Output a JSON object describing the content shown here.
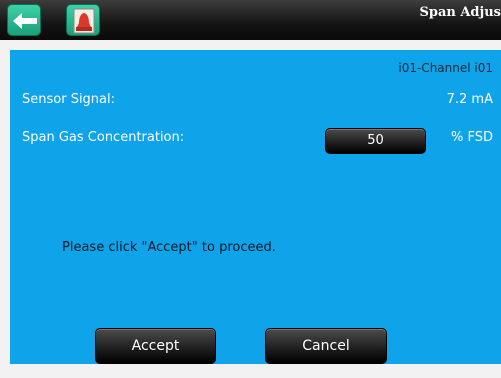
{
  "header": {
    "title": "Span Adjus",
    "back_icon": "back-arrow-icon",
    "alarm_icon": "alarm-bell-icon",
    "accent_color": "#1aa07a"
  },
  "panel": {
    "background_color": "#0fa3ea",
    "channel": "i01-Channel i01",
    "sensor_signal_label": "Sensor Signal:",
    "sensor_signal_value": "7.2 mA",
    "span_gas_label": "Span Gas Concentration:",
    "span_gas_value": "50",
    "span_gas_unit": "% FSD",
    "message": "Please click \"Accept\" to proceed.",
    "accept_label": "Accept",
    "cancel_label": "Cancel"
  }
}
